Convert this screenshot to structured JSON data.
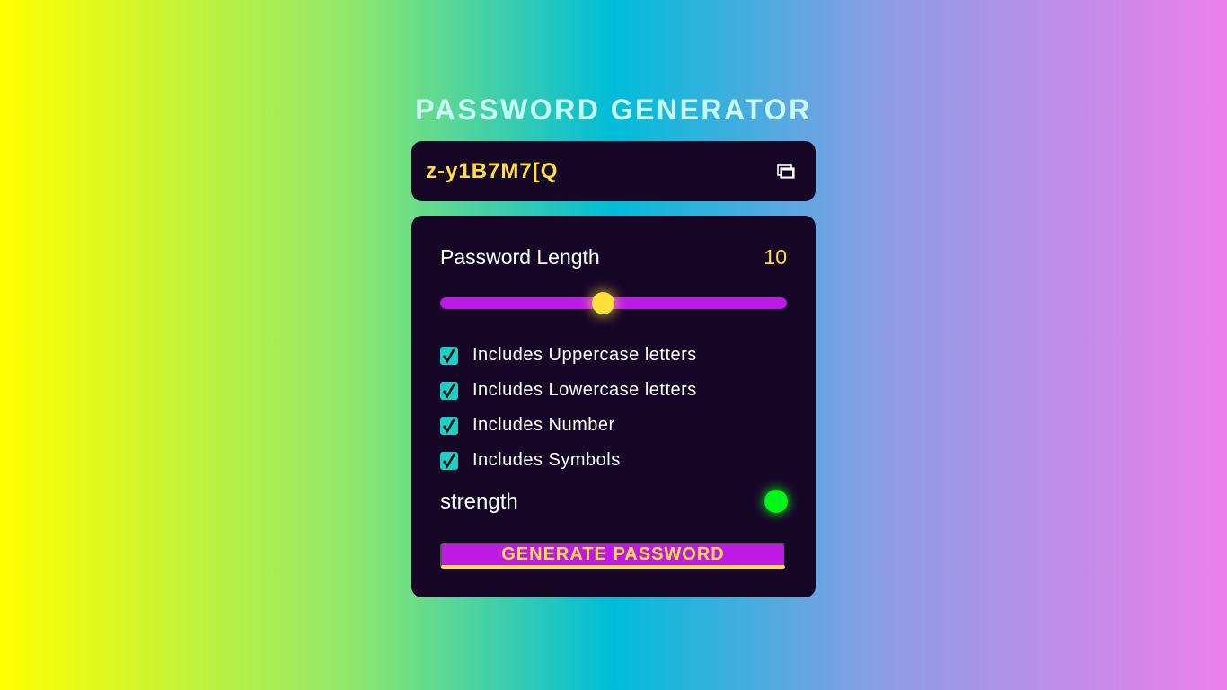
{
  "app": {
    "title": "PASSWORD GENERATOR"
  },
  "display": {
    "password": "z-y1B7M7[Q",
    "copy_icon": "copy-icon"
  },
  "length": {
    "label": "Password Length",
    "value": "10",
    "slider_fraction": 0.47
  },
  "options": [
    {
      "label": "Includes Uppercase letters",
      "checked": true
    },
    {
      "label": "Includes Lowercase letters",
      "checked": true
    },
    {
      "label": "Includes Number",
      "checked": true
    },
    {
      "label": "Includes Symbols",
      "checked": true
    }
  ],
  "strength": {
    "label": "strength",
    "indicator_color": "#00f518"
  },
  "generate": {
    "label": "GENERATE PASSWORD"
  },
  "colors": {
    "accent_yellow": "#ffe044",
    "accent_purple": "#be1ae6",
    "panel_bg": "#170727",
    "checkbox_teal": "#1ecfc5"
  }
}
